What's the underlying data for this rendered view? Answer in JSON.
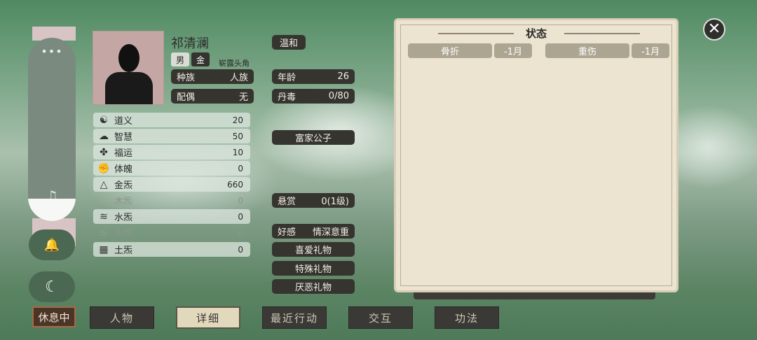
{
  "character": {
    "name": "祁清澜",
    "gender": "男",
    "root": "金",
    "title": "崭露头角",
    "temperament": "温和",
    "race_label": "种族",
    "race": "人族",
    "spouse_label": "配偶",
    "spouse": "无",
    "age_label": "年龄",
    "age": "26",
    "poison_label": "丹毒",
    "poison": "0/80",
    "background": "富家公子",
    "bounty_label": "悬赏",
    "bounty": "0(1级)",
    "favor_label": "好感",
    "favor": "情深意重",
    "gift_like": "喜爱礼物",
    "gift_special": "特殊礼物",
    "gift_hate": "厌恶礼物"
  },
  "stats": [
    {
      "icon": "yin-yang-icon",
      "glyph": "☯",
      "label": "道义",
      "value": "20"
    },
    {
      "icon": "brain-icon",
      "glyph": "☁",
      "label": "智慧",
      "value": "50"
    },
    {
      "icon": "clover-icon",
      "glyph": "✤",
      "label": "福运",
      "value": "10"
    },
    {
      "icon": "fist-icon",
      "glyph": "✊",
      "label": "体魄",
      "value": "0"
    },
    {
      "icon": "metal-icon",
      "glyph": "△",
      "label": "金炁",
      "value": "660"
    },
    {
      "icon": "wood-icon",
      "glyph": "◇",
      "label": "木炁",
      "value": "0"
    },
    {
      "icon": "water-icon",
      "glyph": "≋",
      "label": "水炁",
      "value": "0"
    },
    {
      "icon": "fire-icon",
      "glyph": "♨",
      "label": "火炁",
      "value": "0"
    },
    {
      "icon": "earth-icon",
      "glyph": "▦",
      "label": "土炁",
      "value": "0"
    }
  ],
  "status_panel": {
    "title": "状态",
    "effects": [
      {
        "name": "骨折",
        "duration": "-1月"
      },
      {
        "name": "重伤",
        "duration": "-1月"
      }
    ]
  },
  "tabs": {
    "resting": "休息中",
    "character": "人物",
    "details": "详细",
    "recent": "最近行动",
    "interact": "交互",
    "skills": "功法"
  },
  "system": {
    "more": "•••",
    "music_glyph": "♫",
    "bell_glyph": "🔔",
    "moon_glyph": "☾",
    "close_glyph": "✕"
  }
}
